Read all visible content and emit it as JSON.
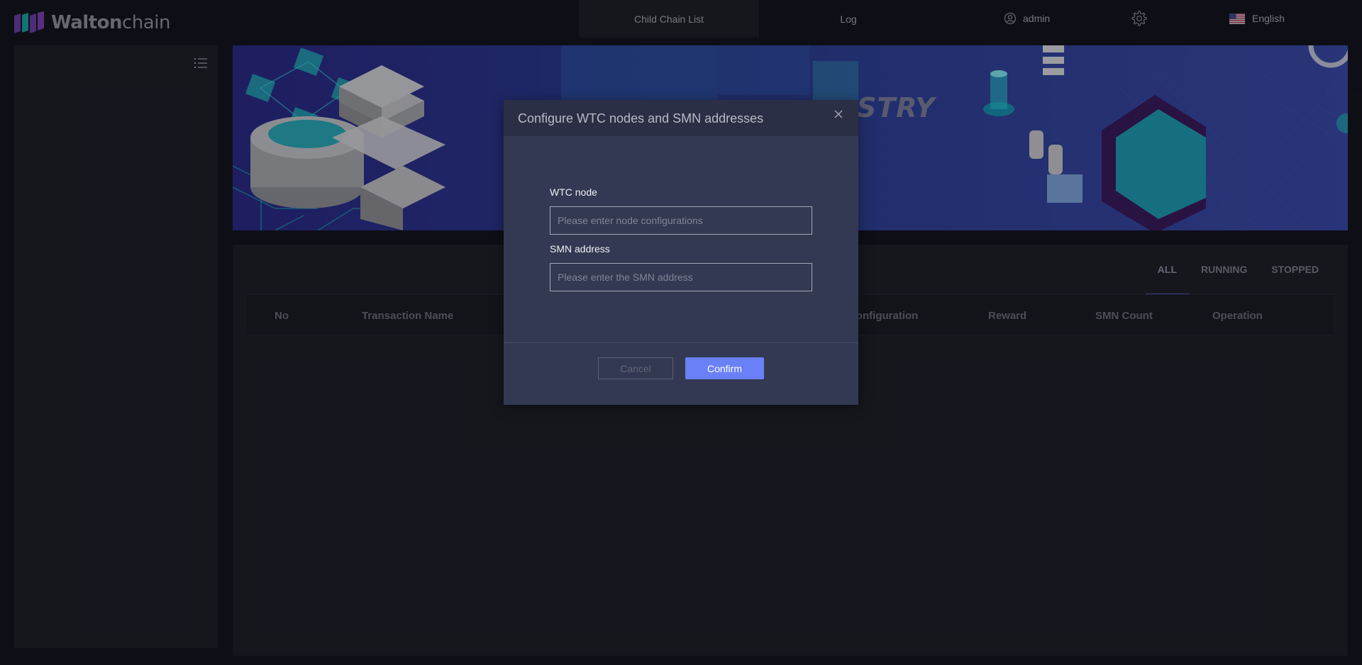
{
  "header": {
    "logo_text_bold": "Walton",
    "logo_text_regular": "chain",
    "nav": [
      {
        "label": "Child Chain List",
        "active": true
      },
      {
        "label": "Log",
        "active": false
      }
    ],
    "user_label": "admin",
    "language_label": "English"
  },
  "banner": {
    "title_fragment": "STRY"
  },
  "filters": {
    "tabs": [
      "ALL",
      "RUNNING",
      "STOPPED"
    ],
    "active": "ALL"
  },
  "table": {
    "columns": [
      "No",
      "Transaction Name",
      "Configuration",
      "Reward",
      "SMN Count",
      "Operation"
    ]
  },
  "modal": {
    "title": "Configure WTC nodes and SMN addresses",
    "wtc_label": "WTC node",
    "wtc_placeholder": "Please enter node configurations",
    "smn_label": "SMN address",
    "smn_placeholder": "Please enter the SMN address",
    "cancel_label": "Cancel",
    "confirm_label": "Confirm"
  },
  "colors": {
    "background": "#14161f",
    "panel": "#1e2029",
    "modal": "#333952",
    "accent": "#6a80f7"
  }
}
